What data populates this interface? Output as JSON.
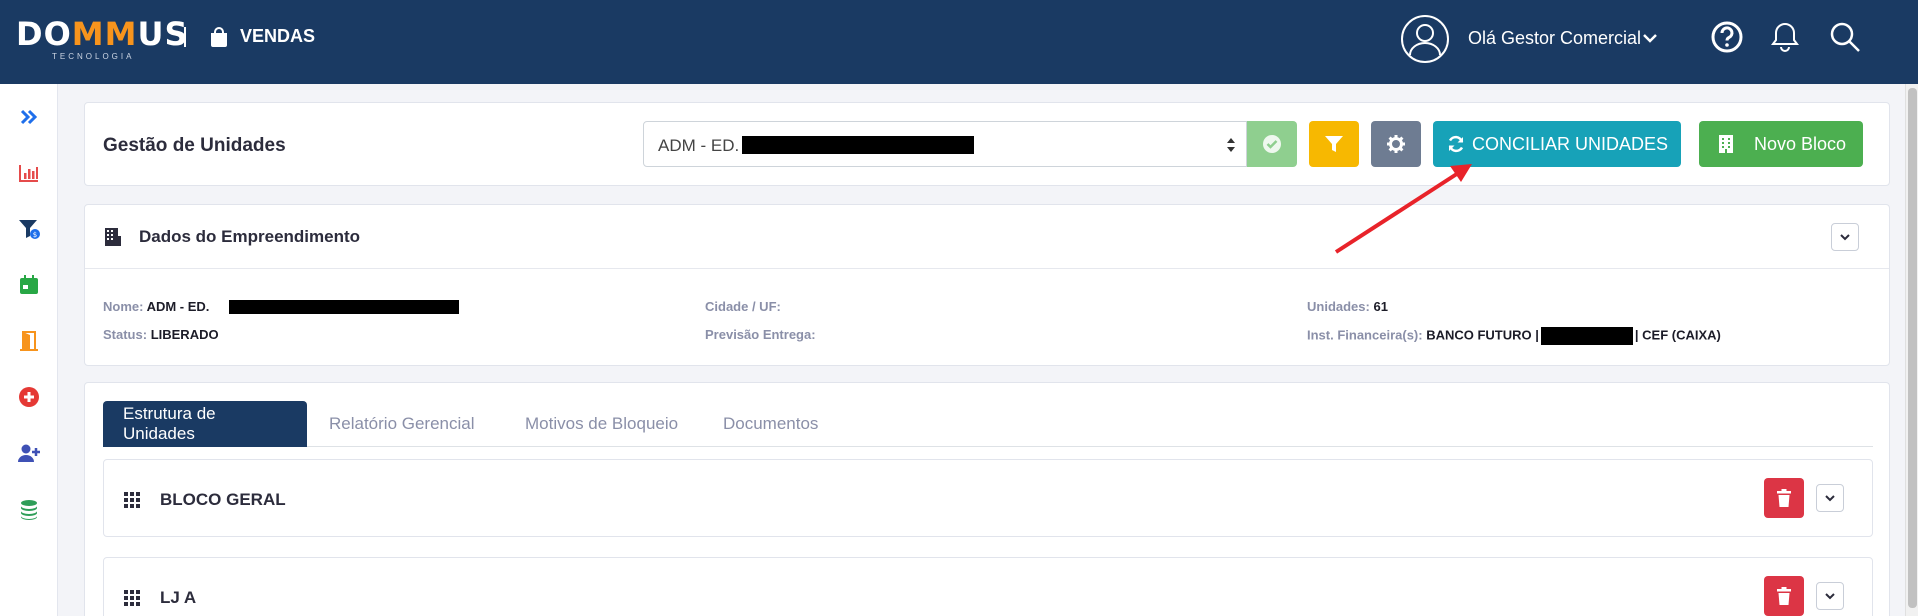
{
  "app": {
    "logo_text_a": "DO",
    "logo_text_m": "MM",
    "logo_text_b": "US",
    "logo_sub": "TECNOLOGIA",
    "module": "VENDAS",
    "user_greeting": "Olá Gestor Comercial"
  },
  "sidebar": {
    "items": [
      {
        "icon": "double-chevron-right-icon",
        "color": "#1f6feb"
      },
      {
        "icon": "bar-chart-icon",
        "color": "#e54b4b"
      },
      {
        "icon": "funnel-dollar-icon",
        "color": "#1a3a63"
      },
      {
        "icon": "calendar-icon",
        "color": "#28a745"
      },
      {
        "icon": "door-open-icon",
        "color": "#f7941d"
      },
      {
        "icon": "plus-circle-icon",
        "color": "#e53935"
      },
      {
        "icon": "user-plus-icon",
        "color": "#3f51b5"
      },
      {
        "icon": "coins-icon",
        "color": "#2e9e58"
      }
    ]
  },
  "header": {
    "title": "Gestão de Unidades",
    "select_value": "ADM - ED.",
    "conciliar_label": "CONCILIAR UNIDADES",
    "novo_label": "Novo Bloco"
  },
  "empreendimento": {
    "title": "Dados do Empreendimento",
    "nome_label": "Nome:",
    "nome_value": "ADM - ED.",
    "status_label": "Status:",
    "status_value": "LIBERADO",
    "cidade_label": "Cidade / UF:",
    "previsao_label": "Previsão Entrega:",
    "unidades_label": "Unidades:",
    "unidades_value": "61",
    "inst_label": "Inst. Financeira(s):",
    "inst_value_a": "BANCO FUTURO |",
    "inst_value_b": "| CEF (CAIXA)"
  },
  "tabs": [
    {
      "label": "Estrutura de Unidades",
      "active": true
    },
    {
      "label": "Relatório Gerencial",
      "active": false
    },
    {
      "label": "Motivos de Bloqueio",
      "active": false
    },
    {
      "label": "Documentos",
      "active": false
    }
  ],
  "blocks": [
    {
      "name": "BLOCO GERAL"
    },
    {
      "name": "LJ A"
    }
  ],
  "colors": {
    "topbar": "#1a3a63",
    "accent": "#f7941d",
    "conciliar": "#17a2b8",
    "novo": "#4caf50",
    "delete": "#dc3545"
  }
}
